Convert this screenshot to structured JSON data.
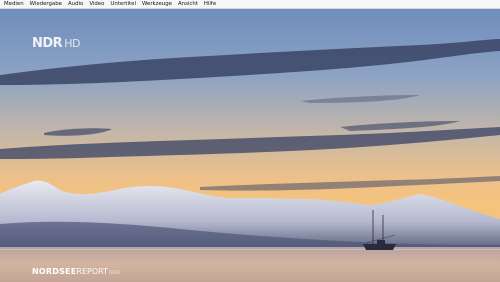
{
  "menu": {
    "items": [
      {
        "label": "Medien"
      },
      {
        "label": "Wiedergabe"
      },
      {
        "label": "Audio"
      },
      {
        "label": "Video"
      },
      {
        "label": "Untertitel"
      },
      {
        "label": "Werkzeuge"
      },
      {
        "label": "Ansicht"
      },
      {
        "label": "Hilfe"
      }
    ]
  },
  "video": {
    "channel_logo": "NDR",
    "channel_logo_suffix": "HD",
    "program_caption_bold": "NORDSEE",
    "program_caption_regular": "REPORT",
    "program_caption_small": "NDR",
    "colors": {
      "sky_top": "#6f8fbd",
      "sky_mid": "#c9b9a8",
      "horizon": "#f3c27a",
      "sea": "#d4b4a0"
    }
  }
}
